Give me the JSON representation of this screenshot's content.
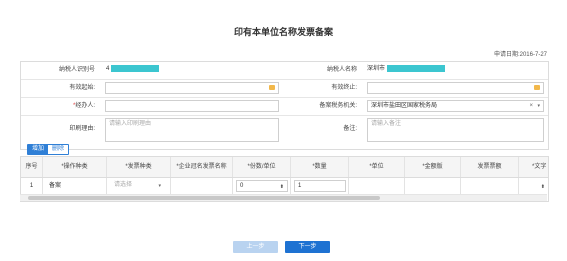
{
  "page": {
    "title": "印有本单位名称发票备案",
    "apply_date": "申请日期:2016-7-27"
  },
  "form": {
    "taxpayer_id_label": "纳税人识别号",
    "taxpayer_id_prefix": "4",
    "taxpayer_name_label": "纳税人名称",
    "taxpayer_name_prefix": "深圳市",
    "valid_start_label": "有效起始:",
    "valid_end_label": "有效终止:",
    "handler_label": "经办人:",
    "tax_office_label": "备案税务机关:",
    "tax_office_value": "深圳市盐田区国家税务局",
    "print_reason_label": "印刷理由:",
    "print_reason_placeholder": "请输入印刷理由",
    "remark_label": "备注:",
    "remark_placeholder": "请输入备注",
    "required_mark": "*",
    "clear_symbol": "×",
    "dropdown_symbol": "▾"
  },
  "toolbar": {
    "add_label": "增加",
    "delete_label": "删除"
  },
  "grid": {
    "headers": [
      "序号",
      "*操作种类",
      "*发票种类",
      "*企业冠名发票名称",
      "*份数/单位",
      "*数量",
      "*单位",
      "*金额版",
      "发票票额",
      "*文字"
    ],
    "row": {
      "index": "1",
      "operation": "备案",
      "invoice_type_placeholder": "请选择",
      "copies": "0",
      "quantity": "1",
      "spin_symbol": "⬍"
    }
  },
  "footer": {
    "prev_label": "上一步",
    "next_label": "下一步"
  },
  "colors": {
    "primary": "#1e72d2",
    "mask": "#3cc6d0",
    "required": "#e23b3b"
  }
}
